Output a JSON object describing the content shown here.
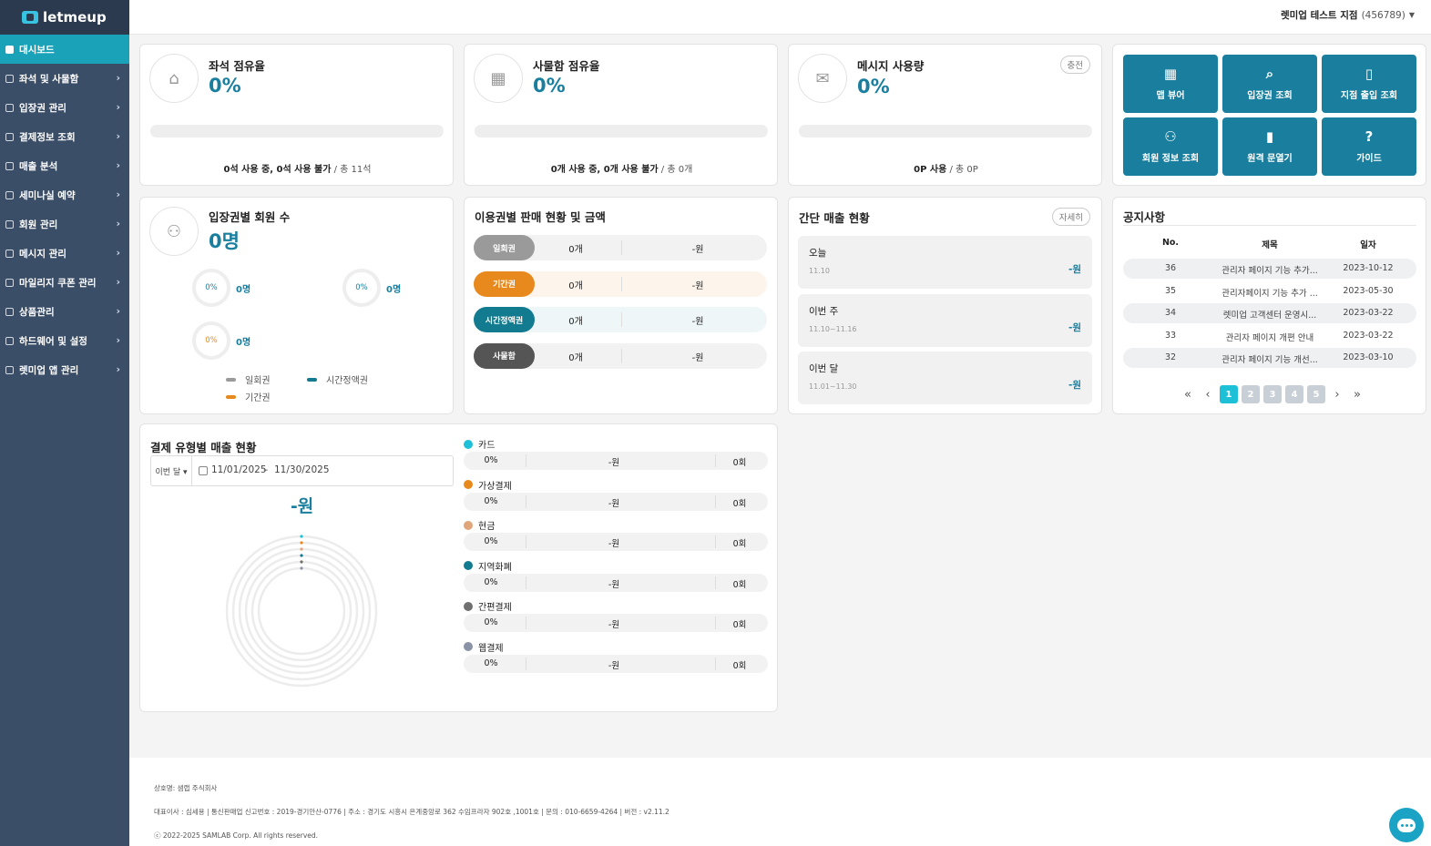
{
  "brand": {
    "name": "letmeup"
  },
  "topbar": {
    "store_name": "렛미업 테스트 지점",
    "store_code": "(456789)",
    "caret": "▼"
  },
  "sidebar": {
    "items": [
      {
        "label": "대시보드",
        "active": true
      },
      {
        "label": "좌석 및 사물함"
      },
      {
        "label": "입장권 관리"
      },
      {
        "label": "결제정보 조회"
      },
      {
        "label": "매출 분석"
      },
      {
        "label": "세미나실 예약"
      },
      {
        "label": "회원 관리"
      },
      {
        "label": "메시지 관리"
      },
      {
        "label": "마일리지 쿠폰 관리"
      },
      {
        "label": "상품관리"
      },
      {
        "label": "하드웨어 및 설정"
      },
      {
        "label": "렛미업 앱 관리"
      }
    ]
  },
  "seat": {
    "title": "좌석 점유율",
    "pct": "0%",
    "fill": 0,
    "foot_a": "0석 사용 중, 0석 사용 불가",
    "foot_b": " / 총 11석"
  },
  "locker": {
    "title": "사물함 점유율",
    "pct": "0%",
    "fill": 0,
    "foot_a": "0개 사용 중, 0개 사용 불가",
    "foot_b": " / 총 0개"
  },
  "message": {
    "title": "메시지 사용량",
    "pct": "0%",
    "fill": 0,
    "badge": "충전",
    "foot_a": "0P 사용",
    "foot_b": " / 총 0P"
  },
  "quick": {
    "tiles": [
      {
        "label": "맵 뷰어",
        "icon": "map-icon",
        "glyph": "▦"
      },
      {
        "label": "입장권 조회",
        "icon": "ticket-search-icon",
        "glyph": "⌕"
      },
      {
        "label": "지점 출입 조회",
        "icon": "door-search-icon",
        "glyph": "▯"
      },
      {
        "label": "회원 정보 조회",
        "icon": "member-search-icon",
        "glyph": "⚇"
      },
      {
        "label": "원격 문열기",
        "icon": "remote-door-icon",
        "glyph": "▮"
      },
      {
        "label": "가이드",
        "icon": "help-icon",
        "glyph": "?"
      }
    ]
  },
  "members": {
    "title": "입장권별 회원 수",
    "total": "0명",
    "rings": [
      {
        "pct": "0%",
        "value": "0명",
        "color": "#1a7f9e"
      },
      {
        "pct": "0%",
        "value": "0명",
        "color": "#1a7f9e"
      },
      {
        "pct": "0%",
        "value": "0명",
        "color": "#e8891e"
      }
    ],
    "legend": [
      {
        "label": "일회권",
        "color": "#9a9a9a"
      },
      {
        "label": "시간정액권",
        "color": "#137b8f"
      },
      {
        "label": "기간권",
        "color": "#e8891e"
      }
    ]
  },
  "ticket_sales": {
    "title": "이용권별 판매 현황 및 금액",
    "rows": [
      {
        "tag": "일회권",
        "count": "0개",
        "amount": "-원",
        "color": "#9a9a9a",
        "bg": "#f2f2f2"
      },
      {
        "tag": "기간권",
        "count": "0개",
        "amount": "-원",
        "color": "#e8891e",
        "bg": "#fdf5ec"
      },
      {
        "tag": "시간정액권",
        "count": "0개",
        "amount": "-원",
        "color": "#137b8f",
        "bg": "#eef6f8"
      },
      {
        "tag": "사물함",
        "count": "0개",
        "amount": "-원",
        "color": "#555555",
        "bg": "#f2f2f2"
      }
    ]
  },
  "simple_sales": {
    "title": "간단 매출 현황",
    "detail": "자세히",
    "rows": [
      {
        "label": "오늘",
        "range": "11.10",
        "value": "-원"
      },
      {
        "label": "이번 주",
        "range": "11.10~11.16",
        "value": "-원"
      },
      {
        "label": "이번 달",
        "range": "11.01~11.30",
        "value": "-원"
      }
    ]
  },
  "notices": {
    "title": "공지사항",
    "headers": {
      "no": "No.",
      "title": "제목",
      "date": "일자"
    },
    "rows": [
      {
        "no": "36",
        "title": "관리자 페이지 기능 추가...",
        "date": "2023-10-12"
      },
      {
        "no": "35",
        "title": "관리자페이지 기능 추가 ...",
        "date": "2023-05-30"
      },
      {
        "no": "34",
        "title": "렛미업 고객센터 운영시...",
        "date": "2023-03-22"
      },
      {
        "no": "33",
        "title": "관리자 페이지 개편 안내",
        "date": "2023-03-22"
      },
      {
        "no": "32",
        "title": "관리자 페이지 기능 개선...",
        "date": "2023-03-10"
      }
    ],
    "pager": {
      "first": "«",
      "prev": "‹",
      "next": "›",
      "last": "»",
      "pages": [
        "1",
        "2",
        "3",
        "4",
        "5"
      ],
      "current": "1"
    }
  },
  "payment": {
    "title": "결제 유형별 매출 현황",
    "period": "이번 달 ▾",
    "date_from": "11/01/2025",
    "date_sep": "–",
    "date_to": "11/30/2025",
    "total": "-원",
    "types": [
      {
        "name": "카드",
        "color": "#1ec0d8",
        "pct": "0%",
        "amount": "-원",
        "count": "0회"
      },
      {
        "name": "가상결제",
        "color": "#e8891e",
        "pct": "0%",
        "amount": "-원",
        "count": "0회"
      },
      {
        "name": "현금",
        "color": "#e0a57a",
        "pct": "0%",
        "amount": "-원",
        "count": "0회"
      },
      {
        "name": "지역화폐",
        "color": "#137b8f",
        "pct": "0%",
        "amount": "-원",
        "count": "0회"
      },
      {
        "name": "간편결제",
        "color": "#6f6f6f",
        "pct": "0%",
        "amount": "-원",
        "count": "0회"
      },
      {
        "name": "웹결제",
        "color": "#8a93a6",
        "pct": "0%",
        "amount": "-원",
        "count": "0회"
      }
    ]
  },
  "footer": {
    "company": "상호명: 샘랩 주식회사",
    "info": "대표이사 : 심세용  |  통신판매업 신고번호 : 2019-경기안산-0776  |  주소 : 경기도 시흥시 은계중앙로 362 수임프라자 902호 ,1001호  |  문의 : 010-6659-4264  |  버전 : v2.11.2",
    "copyright": "ⓒ 2022-2025 SAMLAB Corp. All rights reserved."
  }
}
